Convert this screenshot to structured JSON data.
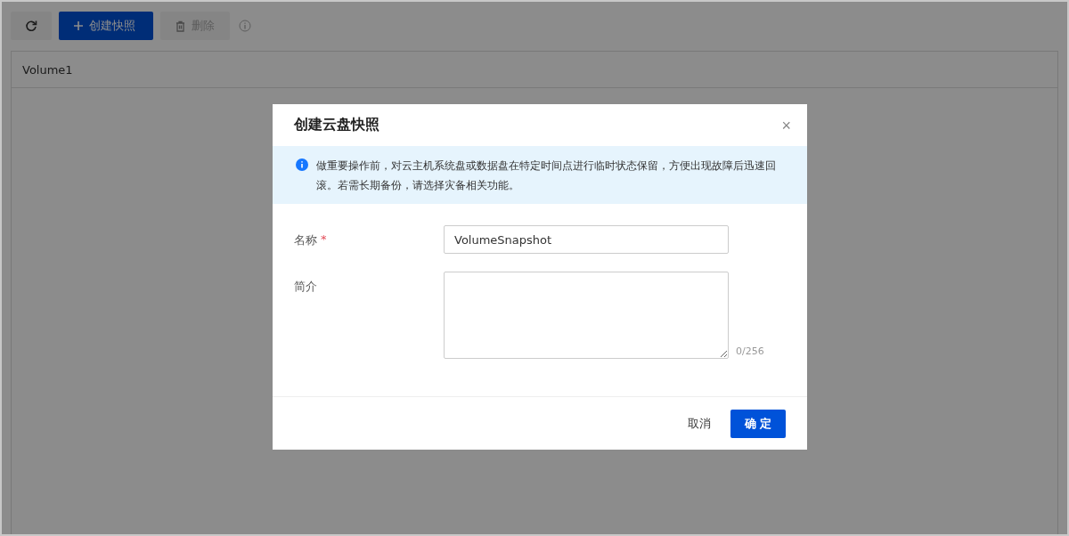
{
  "toolbar": {
    "buttons": [
      {
        "kind": "refresh"
      },
      {
        "kind": "create",
        "label": "创建快照"
      },
      {
        "kind": "delete",
        "label": "删除",
        "disabled": true
      }
    ]
  },
  "table": {
    "columns": [
      "Volume1"
    ]
  },
  "dialog": {
    "title": "创建云盘快照",
    "close_symbol": "×",
    "notice": "做重要操作前，对云主机系统盘或数据盘在特定时间点进行临时状态保留，方便出现故障后迅速回滚。若需长期备份，请选择灾备相关功能。",
    "fields": [
      {
        "kind": "input",
        "label": "名称",
        "required_mark": "*",
        "value": "VolumeSnapshot"
      },
      {
        "kind": "textarea",
        "label": "简介",
        "counter": "0/256"
      }
    ],
    "buttons": [
      {
        "kind": "cancel",
        "label": "取消"
      },
      {
        "kind": "primary",
        "label": "确 定"
      }
    ]
  }
}
